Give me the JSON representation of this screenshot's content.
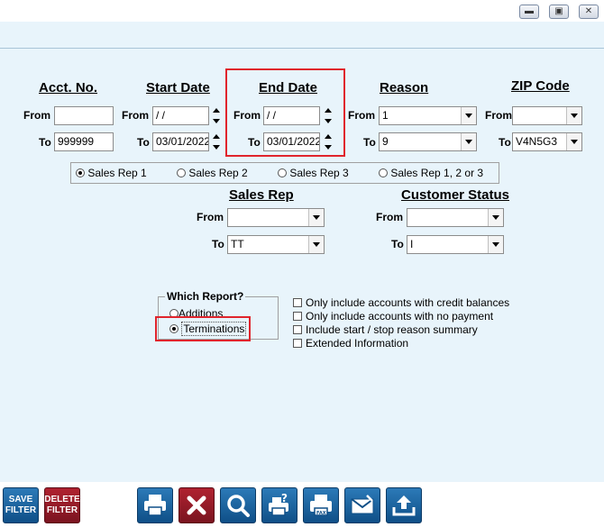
{
  "window": {
    "minimize": "▬",
    "restore": "▣",
    "close": "✕"
  },
  "acct": {
    "header": "Acct. No.",
    "from_label": "From",
    "to_label": "To",
    "from_value": "",
    "to_value": "999999"
  },
  "start_date": {
    "header": "Start Date",
    "from_label": "From",
    "to_label": "To",
    "from_value": " / /",
    "to_value": "03/01/2022"
  },
  "end_date": {
    "header": "End Date",
    "from_label": "From",
    "to_label": "To",
    "from_value": " / /",
    "to_value": "03/01/2022"
  },
  "reason": {
    "header": "Reason",
    "from_label": "From",
    "to_label": "To",
    "from_value": "1",
    "to_value": "9"
  },
  "zip": {
    "header": "ZIP Code",
    "from_label": "From",
    "to_label": "To",
    "from_value": "",
    "to_value": "V4N5G3"
  },
  "sales_rep_options": [
    {
      "label": "Sales Rep 1",
      "selected": true
    },
    {
      "label": "Sales Rep 2",
      "selected": false
    },
    {
      "label": "Sales Rep 3",
      "selected": false
    },
    {
      "label": "Sales Rep 1, 2 or 3",
      "selected": false
    }
  ],
  "sales_rep": {
    "header": "Sales Rep",
    "from_label": "From",
    "to_label": "To",
    "from_value": "",
    "to_value": "TT"
  },
  "customer_status": {
    "header": "Customer Status",
    "from_label": "From",
    "to_label": "To",
    "from_value": "",
    "to_value": "I"
  },
  "which_report": {
    "legend": "Which Report?",
    "options": [
      {
        "label": "Additions",
        "selected": false
      },
      {
        "label": "Terminations",
        "selected": true
      }
    ]
  },
  "checkboxes": [
    {
      "label": "Only include accounts with credit balances",
      "checked": false
    },
    {
      "label": "Only include accounts with no payment",
      "checked": false
    },
    {
      "label": "Include start / stop reason summary",
      "checked": false
    },
    {
      "label": "Extended Information",
      "checked": false
    }
  ],
  "toolbar": {
    "save_filter": [
      "SAVE",
      "FILTER"
    ],
    "delete_filter": [
      "DELETE",
      "FILTER"
    ],
    "icons": [
      "print-icon",
      "cancel-icon",
      "search-icon",
      "print-preview-icon",
      "fax-icon",
      "email-icon",
      "export-icon"
    ]
  },
  "colors": {
    "panel": "#e8f4fb",
    "highlight": "#e0242c",
    "button": "#1a5f9e",
    "delete_button": "#8b1a26"
  }
}
